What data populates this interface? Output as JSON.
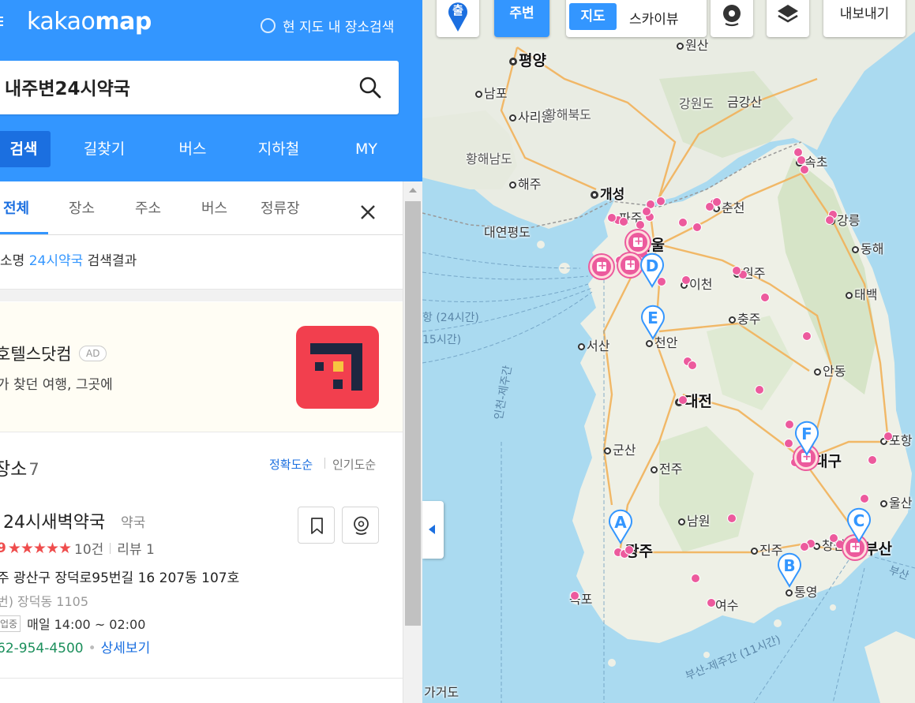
{
  "app": {
    "logo_light": "kakao",
    "logo_bold": "map",
    "area_search_label": "현 지도 내 장소검색"
  },
  "search": {
    "value": "내주변24시약국",
    "placeholder": ""
  },
  "main_tabs": [
    {
      "label": "검색",
      "active": true
    },
    {
      "label": "길찾기"
    },
    {
      "label": "버스"
    },
    {
      "label": "지하철"
    },
    {
      "label": "MY"
    }
  ],
  "sub_tabs": [
    {
      "label": "전체",
      "active": true
    },
    {
      "label": "장소"
    },
    {
      "label": "주소"
    },
    {
      "label": "버스"
    },
    {
      "label": "정류장"
    }
  ],
  "result_note": {
    "prefix": "소명 ",
    "highlight": "24시약국",
    "suffix": " 검색결과"
  },
  "ad": {
    "title": "호텔스닷컴",
    "badge": "AD",
    "desc": "가 찾던 여행, 그곳에"
  },
  "places": {
    "title": "장소",
    "count": "7",
    "sort_accuracy": "정확도순",
    "sort_popular": "인기도순"
  },
  "item": {
    "name": "24시새벽약국",
    "category": "약국",
    "score": "9",
    "stars": "★★★★★",
    "review_count": "10건",
    "review_label": "리뷰 1",
    "address": "주 광산구 장덕로95번길 16 207동 107호",
    "jibun": "번) 장덕동 1105",
    "hours_tag": "업중",
    "hours": "매일 14:00 ~ 02:00",
    "phone": "62-954-4500",
    "detail_link": "상세보기"
  },
  "map_controls": {
    "start": "출",
    "nearby": "주변",
    "map": "지도",
    "skyview": "스카이뷰",
    "export": "내보내기"
  },
  "map_labels": {
    "pyongyang": "평양",
    "nampo": "남포",
    "sariwon": "사리원",
    "hwanghae_n": "황해북도",
    "hwanghae_s": "황해남도",
    "haeju": "해주",
    "kaesong": "개성",
    "gangwon": "강원도",
    "geumgangsan": "금강산",
    "sokcho": "속초",
    "chuncheon": "춘천",
    "gangneung": "강릉",
    "donghae": "동해",
    "paju": "파주",
    "seoul": "서울",
    "wonju": "원주",
    "icheon": "이천",
    "taebaek": "태백",
    "chungju": "충주",
    "seosan": "서산",
    "cheonan": "천안",
    "andong": "안동",
    "daejeon": "대전",
    "gunsan": "군산",
    "jeonju": "전주",
    "daegu": "대구",
    "pohang": "포항",
    "ulsan": "울산",
    "namwon": "남원",
    "gwangju": "광주",
    "jinju": "진주",
    "changwon": "창원",
    "busan": "부산",
    "mokpo": "목포",
    "yeosu": "여수",
    "tongyeong": "통영",
    "daeyeonpyeong": "대연평도",
    "gageodo": "가거도",
    "sinhan": "원산",
    "incheon_jeju": "인천-제주간",
    "busan_jeju": "부산-제주간 (11시간)",
    "ferry_24": "항 (24시간)",
    "ferry_15": "15시간)",
    "busan_ferry": "부산"
  },
  "markers": [
    "A",
    "B",
    "C",
    "D",
    "E",
    "F"
  ],
  "colors": {
    "brand_blue": "#3396ff",
    "active_blue": "#1b6fe0",
    "poi_pink": "#ec5a9d",
    "phone_green": "#1c8f5c",
    "star_red": "#ef4d4d",
    "sea": "#aadaf0"
  },
  "icons": {
    "menu": "menu-icon",
    "search": "search-icon",
    "close": "close-icon",
    "bookmark": "bookmark-icon",
    "pin": "map-pin-icon",
    "layers": "layers-icon",
    "collapse": "chevron-left-icon"
  }
}
